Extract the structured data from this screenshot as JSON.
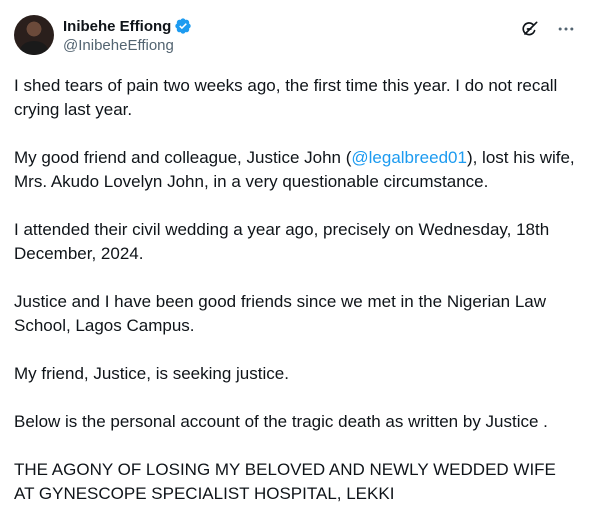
{
  "author": {
    "display_name": "Inibehe Effiong",
    "handle": "@InibeheEffiong",
    "verified_color": "#1d9bf0"
  },
  "icons": {
    "grok": "grok-icon",
    "more": "more-icon",
    "verified": "verified-badge-icon"
  },
  "tweet": {
    "p1": "I shed tears of pain two weeks ago, the first time this year. I do not recall crying last year.",
    "p2_before": "My good friend and colleague, Justice John (",
    "p2_mention": "@legalbreed01",
    "p2_after": "), lost his wife, Mrs. Akudo Lovelyn John, in a very questionable circumstance.",
    "p3": "I attended their civil wedding a year ago, precisely on Wednesday, 18th December, 2024.",
    "p4": "Justice and I have been good friends since we met in the Nigerian Law School, Lagos Campus.",
    "p5": "My friend, Justice, is seeking justice.",
    "p6": "Below is the personal account of the tragic death as written by Justice .",
    "p7": "THE AGONY OF LOSING MY BELOVED AND NEWLY WEDDED WIFE AT GYNESCOPE SPECIALIST HOSPITAL, LEKKI"
  }
}
